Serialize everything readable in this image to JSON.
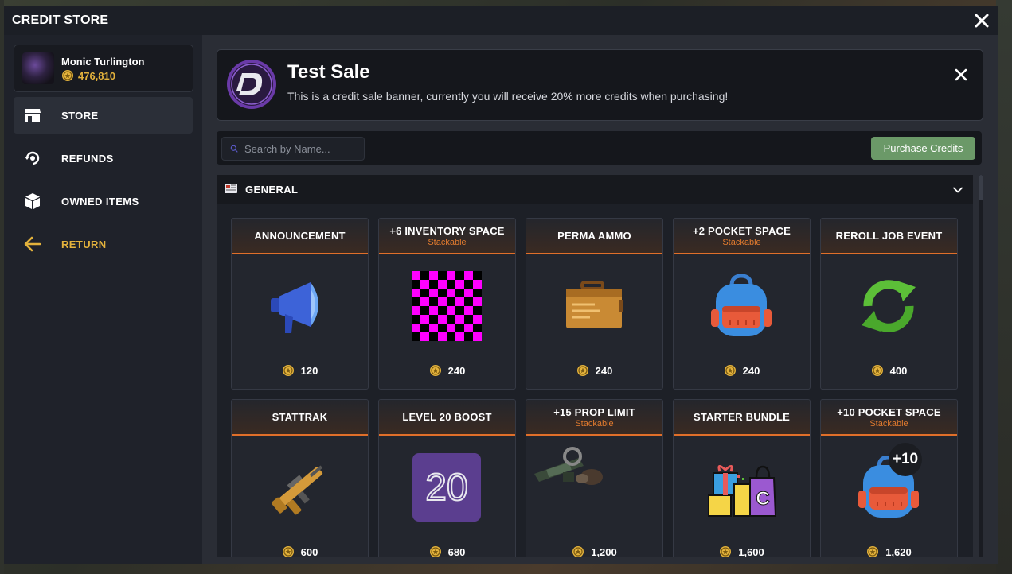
{
  "window": {
    "title": "CREDIT STORE"
  },
  "profile": {
    "name": "Monic Turlington",
    "credits": "476,810"
  },
  "nav": {
    "items": [
      {
        "label": "STORE",
        "icon": "store-icon",
        "active": true
      },
      {
        "label": "REFUNDS",
        "icon": "refund-icon",
        "active": false
      },
      {
        "label": "OWNED ITEMS",
        "icon": "box-icon",
        "active": false
      },
      {
        "label": "RETURN",
        "icon": "arrow-left-icon",
        "active": false
      }
    ]
  },
  "banner": {
    "title": "Test Sale",
    "text": "This is a credit sale banner, currently you will receive 20% more credits when purchasing!"
  },
  "toolbar": {
    "search_placeholder": "Search by Name...",
    "purchase_label": "Purchase Credits"
  },
  "section": {
    "title": "GENERAL"
  },
  "items": [
    {
      "name": "ANNOUNCEMENT",
      "sub": "",
      "price": "120",
      "icon": "megaphone-icon"
    },
    {
      "name": "+6 INVENTORY SPACE",
      "sub": "Stackable",
      "price": "240",
      "icon": "missing-texture-icon"
    },
    {
      "name": "PERMA AMMO",
      "sub": "",
      "price": "240",
      "icon": "ammo-box-icon"
    },
    {
      "name": "+2 POCKET SPACE",
      "sub": "Stackable",
      "price": "240",
      "icon": "backpack-icon"
    },
    {
      "name": "REROLL JOB EVENT",
      "sub": "",
      "price": "400",
      "icon": "reroll-icon"
    },
    {
      "name": "STATTRAK",
      "sub": "",
      "price": "600",
      "icon": "rifle-icon"
    },
    {
      "name": "LEVEL 20 BOOST",
      "sub": "",
      "price": "680",
      "icon": "level-20-icon",
      "badge": "20"
    },
    {
      "name": "+15 PROP LIMIT",
      "sub": "Stackable",
      "price": "1,200",
      "icon": "props-icon"
    },
    {
      "name": "STARTER BUNDLE",
      "sub": "",
      "price": "1,600",
      "icon": "gift-bundle-icon"
    },
    {
      "name": "+10 POCKET SPACE",
      "sub": "Stackable",
      "price": "1,620",
      "icon": "backpack-plus-icon",
      "badge": "+10"
    }
  ]
}
